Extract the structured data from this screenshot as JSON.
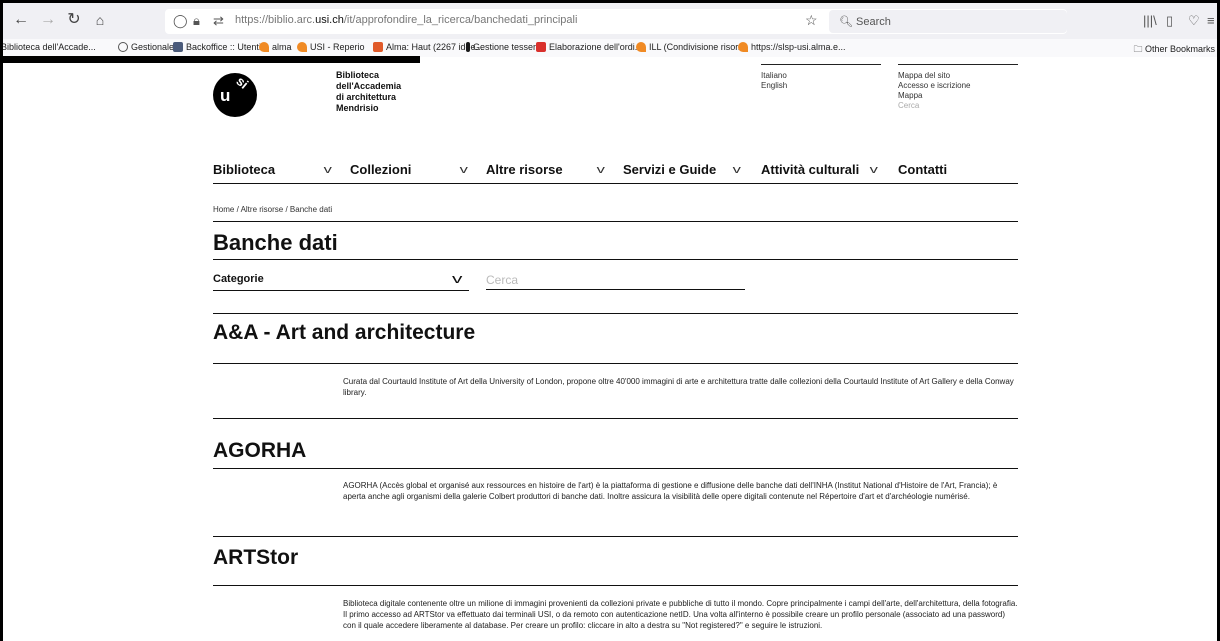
{
  "browser": {
    "url_prefix": "https://biblio.arc.",
    "url_host": "usi.ch",
    "url_path": "/it/approfondire_la_ricerca/banchedati_principali",
    "search_placeholder": "Search",
    "bookmarks": [
      {
        "label": "Biblioteca dell'Accade...",
        "color": "#d0d0d0"
      },
      {
        "label": "Gestionale",
        "color": "#7a8aa0"
      },
      {
        "label": "Backoffice :: Utenti",
        "color": "#4a5a7a"
      },
      {
        "label": "alma",
        "color": "#f08a24"
      },
      {
        "label": "USI - Reperio",
        "color": "#f08a24"
      },
      {
        "label": "Alma: Haut (2267 idée...",
        "color": "#e05a2a"
      },
      {
        "label": "Gestione tessere",
        "color": "#1a1a1a"
      },
      {
        "label": "Elaborazione dell'ordi...",
        "color": "#d9302c"
      },
      {
        "label": "ILL (Condivisione risor...",
        "color": "#f08a24"
      },
      {
        "label": "https://slsp-usi.alma.e...",
        "color": "#f08a24"
      }
    ],
    "other_bookmarks": "Other Bookmarks"
  },
  "site": {
    "logo_u": "u",
    "logo_s": "si",
    "library_name": [
      "Biblioteca",
      "dell'Accademia",
      "di architettura",
      "Mendrisio"
    ],
    "languages": [
      "Italiano",
      "English"
    ],
    "utility_links": [
      "Mappa del sito",
      "Accesso e iscrizione",
      "Mappa"
    ],
    "utility_search": "Cerca",
    "menu": [
      "Biblioteca",
      "Collezioni",
      "Altre risorse",
      "Servizi e Guide",
      "Attività culturali",
      "Contatti"
    ],
    "breadcrumb": "Home / Altre risorse / Banche dati",
    "page_title": "Banche dati",
    "filter_label": "Categorie",
    "search_placeholder": "Cerca"
  },
  "entries": [
    {
      "title": "A&A - Art and architecture",
      "description": "Curata dal Courtauld Institute of Art della University of London, propone oltre 40'000 immagini di arte e architettura tratte dalle collezioni della Courtauld Institute of Art Gallery e della Conway library."
    },
    {
      "title": "AGORHA",
      "description": "AGORHA (Accès global et organisé aux ressources en histoire de l'art) è la piattaforma di gestione e diffusione delle banche dati dell'INHA (Institut National d'Histoire de l'Art, Francia); è aperta anche agli organismi della galerie Colbert produttori di banche dati. Inoltre assicura la visibilità delle opere digitali contenute nel Répertoire d'art et d'archéologie numérisé."
    },
    {
      "title": "ARTStor",
      "description": "Biblioteca digitale contenente oltre un milione di immagini provenienti da collezioni private e pubbliche di tutto il mondo. Copre principalmente i campi dell'arte, dell'architettura, della fotografia. Il primo accesso ad ARTStor va effettuato dai terminali USI, o da remoto con autenticazione netID. Una volta all'interno è possibile creare un profilo personale (associato ad una password) con il quale accedere liberamente al database. Per creare un profilo: cliccare in alto a destra su \"Not registered?\" e seguire le istruzioni."
    }
  ]
}
